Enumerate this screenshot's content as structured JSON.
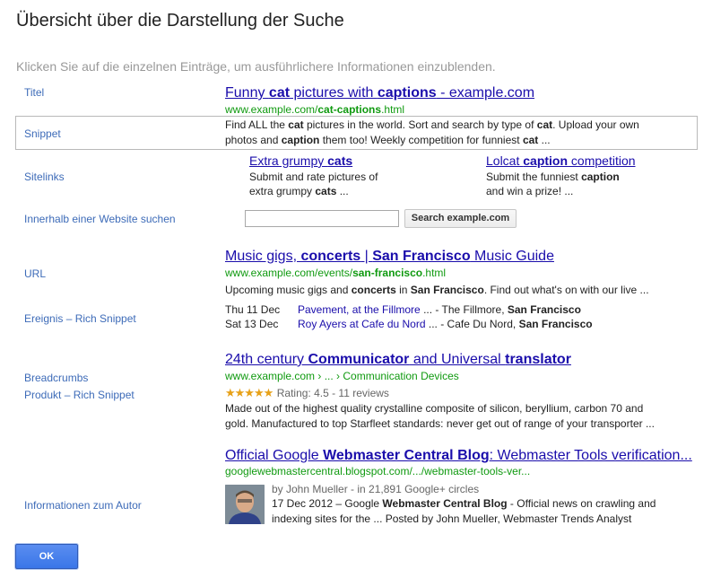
{
  "dialog": {
    "title": "Übersicht über die Darstellung der Suche",
    "subtitle": "Klicken Sie auf die einzelnen Einträge, um ausführlichere Informationen einzublenden.",
    "ok_label": "OK"
  },
  "labels": {
    "titel": "Titel",
    "snippet": "Snippet",
    "sitelinks": "Sitelinks",
    "site_search": "Innerhalb einer Website suchen",
    "url": "URL",
    "event": "Ereignis – Rich Snippet",
    "breadcrumbs": "Breadcrumbs",
    "product": "Produkt – Rich Snippet",
    "author": "Informationen zum Autor"
  },
  "result1": {
    "title_parts": [
      "Funny ",
      "cat",
      " pictures with ",
      "captions",
      " - example.com"
    ],
    "url_parts": [
      "www.example.com/",
      "cat-captions",
      ".html"
    ],
    "desc_line1_parts": [
      "Find ALL the ",
      "cat",
      " pictures in the world. Sort and search by type of ",
      "cat",
      ". Upload your own"
    ],
    "desc_line2_parts": [
      "photos and ",
      "caption",
      " them too! Weekly competition for funniest ",
      "cat",
      " ..."
    ]
  },
  "sitelinks": [
    {
      "title_parts": [
        "Extra grumpy ",
        "cats"
      ],
      "desc_line1_parts": [
        "Submit and rate pictures of"
      ],
      "desc_line2_parts": [
        "extra grumpy ",
        "cats",
        " ..."
      ]
    },
    {
      "title_parts": [
        "Lolcat ",
        "caption",
        " competition"
      ],
      "desc_line1_parts": [
        "Submit the funniest ",
        "caption"
      ],
      "desc_line2_parts": [
        "and win a prize! ..."
      ]
    }
  ],
  "site_search": {
    "input_value": "",
    "button_label": "Search example.com"
  },
  "result2": {
    "title_parts": [
      "Music gigs, ",
      "concerts",
      " | ",
      "San Francisco",
      " Music Guide"
    ],
    "url_parts": [
      "www.example.com/events/",
      "san-francisco",
      ".html"
    ],
    "desc_parts": [
      "Upcoming music gigs and ",
      "concerts",
      " in ",
      "San Francisco",
      ". Find out what's on with our live ..."
    ],
    "events": [
      {
        "date": "Thu 11 Dec",
        "link": "Pavement, at the Fillmore",
        "rest_parts": [
          " ... - The Fillmore, ",
          "San Francisco"
        ]
      },
      {
        "date": "Sat 13 Dec",
        "link": "Roy Ayers at Cafe du Nord",
        "rest_parts": [
          " ... - Cafe Du Nord, ",
          "San Francisco"
        ]
      }
    ]
  },
  "result3": {
    "title_parts": [
      "24th century ",
      "Communicator",
      " and Universal ",
      "translator"
    ],
    "breadcrumb": "www.example.com › ... › Communication Devices",
    "stars": "★★★★★",
    "rating_text": "Rating: 4.5 - 11 reviews",
    "rating_value": 4.5,
    "desc_line1": "Made out of the highest quality crystalline composite of silicon, beryllium, carbon 70 and",
    "desc_line2": "gold. Manufactured to top Starfleet standards: never get out of range of your transporter ..."
  },
  "result4": {
    "title_parts": [
      "Official Google ",
      "Webmaster Central Blog",
      ": Webmaster Tools verification..."
    ],
    "url": "googlewebmastercentral.blogspot.com/.../webmaster-tools-ver...",
    "author_line": "by John Mueller - in 21,891 Google+ circles",
    "desc_line1_parts": [
      "17 Dec 2012 – Google ",
      "Webmaster Central Blog",
      " - Official news on crawling and"
    ],
    "desc_line2": "indexing  sites for the ... Posted by John Mueller, Webmaster Trends Analyst"
  },
  "colors": {
    "label_link": "#3d6bb8",
    "result_title": "#1a0dab",
    "url_green": "#109a10",
    "ok_button": "#3a76e8",
    "star_color": "#e7a118"
  }
}
